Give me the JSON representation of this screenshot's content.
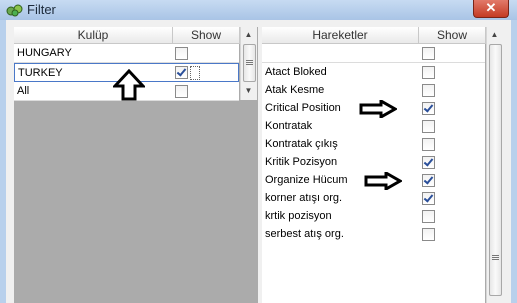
{
  "window": {
    "title": "Filter",
    "close_glyph": "✕"
  },
  "left_table": {
    "col_club": "Kulüp",
    "col_show": "Show",
    "rows": [
      {
        "label": "HUNGARY",
        "checked": false
      },
      {
        "label": "TURKEY",
        "checked": true
      },
      {
        "label": "All",
        "checked": false
      }
    ]
  },
  "right_table": {
    "col_moves": "Hareketler",
    "col_show": "Show",
    "rows": [
      {
        "label": "",
        "checked": false
      },
      {
        "label": "Atact Bloked",
        "checked": false
      },
      {
        "label": "Atak Kesme",
        "checked": false
      },
      {
        "label": "Critical Position",
        "checked": true
      },
      {
        "label": "Kontratak",
        "checked": false
      },
      {
        "label": "Kontratak çıkış",
        "checked": false
      },
      {
        "label": "Kritik Pozisyon",
        "checked": true
      },
      {
        "label": "Organize Hücum",
        "checked": true
      },
      {
        "label": "korner atışı org.",
        "checked": true
      },
      {
        "label": "krtik pozisyon",
        "checked": false
      },
      {
        "label": "serbest atış org.",
        "checked": false
      }
    ]
  },
  "icons": {
    "app": "filter-app-icon",
    "up_arrow": "up-arrow-annotation",
    "right_arrow": "right-arrow-annotation"
  },
  "colors": {
    "title_bg": "#b8d0ec",
    "close": "#c43a24",
    "check": "#2a4f9a"
  }
}
